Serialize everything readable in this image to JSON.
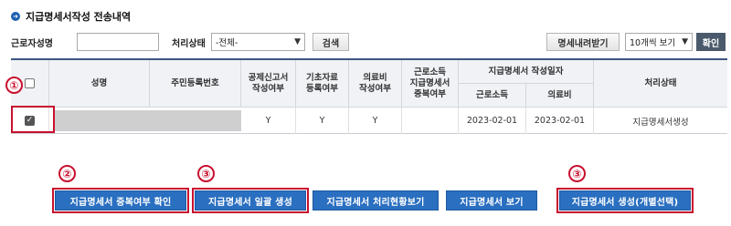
{
  "page": {
    "title_bullet": "➜",
    "title": "지급명세서작성 전송내역"
  },
  "filters": {
    "worker_name_label": "근로자성명",
    "worker_name_value": "",
    "status_label": "처리상태",
    "status_selected": "-전체-",
    "search_button": "검색",
    "download_button": "명세내려받기",
    "page_size_selected": "10개씩 보기",
    "confirm_button": "확인"
  },
  "table": {
    "headers": {
      "name": "성명",
      "rrn": "주민등록번호",
      "deduction_report": "공제신고서\n작성여부",
      "basic_data": "기초자료\n등록여부",
      "medical_expense": "의료비\n작성여부",
      "duplicate_check": "근로소득\n지급명세서\n중복여부",
      "creation_date_group": "지급명세서 작성일자",
      "earned_income": "근로소득",
      "medical": "의료비",
      "status": "처리상태"
    },
    "rows": [
      {
        "checked": true,
        "name": "",
        "rrn": "",
        "deduction_report": "Y",
        "basic_data": "Y",
        "medical_expense": "Y",
        "duplicate_check": "",
        "earned_income_date": "2023-02-01",
        "medical_date": "2023-02-01",
        "status": "지급명세서생성"
      }
    ]
  },
  "annotations": {
    "marker_1": "①",
    "marker_2": "②",
    "marker_3a": "③",
    "marker_3b": "③",
    "color": "#c8102e"
  },
  "actions": {
    "duplicate_check": "지급명세서 중복여부 확인",
    "bulk_create": "지급명세서 일괄 생성",
    "processing_status": "지급명세서 처리현황보기",
    "view": "지급명세서 보기",
    "create_selected": "지급명세서 생성(개별선택)"
  },
  "colors": {
    "primary_blue": "#2a6fc0",
    "header_border": "#3d5680",
    "dark_button": "#4a5a6c"
  }
}
